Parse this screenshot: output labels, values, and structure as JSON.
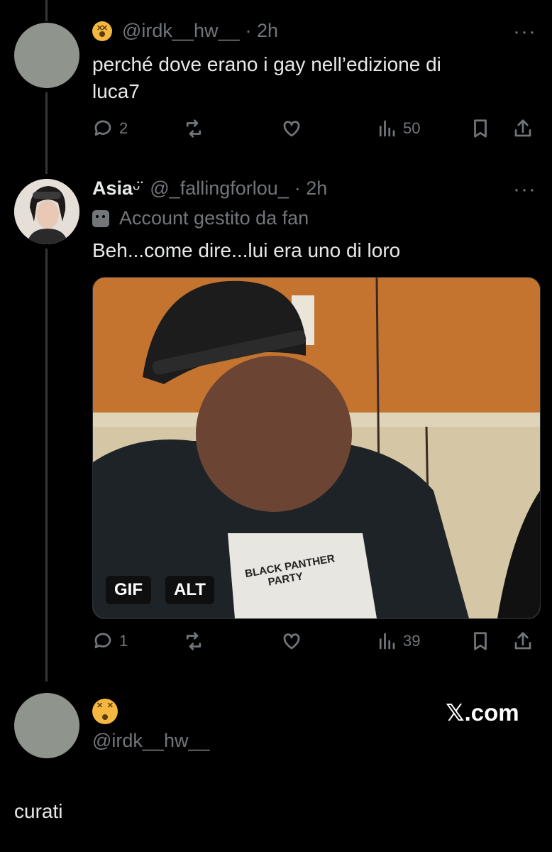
{
  "tweet1": {
    "handle": "@irdk__hw__",
    "time": "· 2h",
    "text_line1": "perché dove erano i gay nell’edizione di",
    "text_line2": "luca7",
    "replies": "2",
    "views": "50",
    "more": "···"
  },
  "tweet2": {
    "name": "Asia",
    "name_suffix": "ᵕ̈",
    "handle": "@_fallingforlou_",
    "time": "· 2h",
    "label": "Account gestito da fan",
    "text": "Beh...come dire...lui era uno di loro",
    "replies": "1",
    "views": "39",
    "more": "···",
    "gif_badge": "GIF",
    "alt_badge": "ALT",
    "shirt_text_1": "BLACK PANTHER",
    "shirt_text_2": "PARTY"
  },
  "tweet3": {
    "handle": "@irdk__hw__",
    "text": "curati",
    "watermark": ".com"
  },
  "icons": {
    "reply": "reply-icon",
    "retweet": "retweet-icon",
    "like": "heart-icon",
    "views": "views-icon",
    "bookmark": "bookmark-icon",
    "share": "share-icon",
    "emoji": "dizzy-face-emoji-icon",
    "mask": "theater-mask-icon"
  },
  "colors": {
    "background": "#000000",
    "text": "#e7e9ea",
    "muted": "#71767b"
  }
}
